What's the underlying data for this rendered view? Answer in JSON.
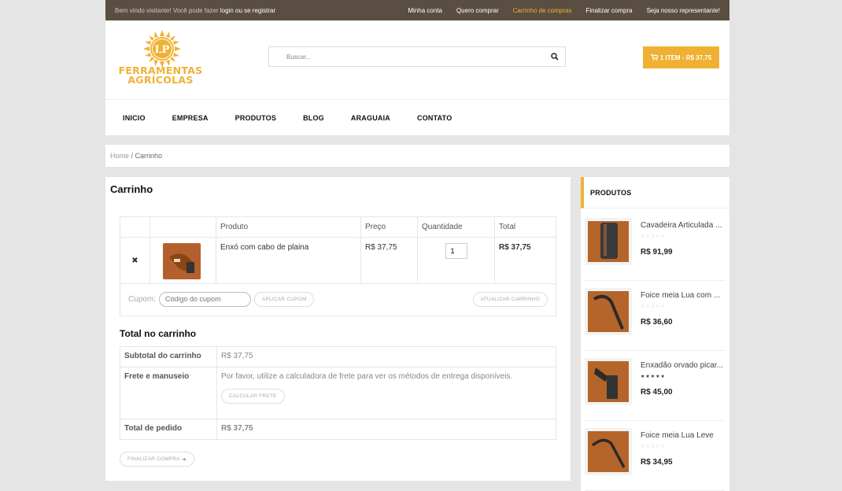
{
  "topbar": {
    "welcome": "Bem vindo visitante! Você pode fazer",
    "login": "login ou se registrar",
    "links": [
      "Minha conta",
      "Quero comprar",
      "Carrinho de compras",
      "Finalizar compra",
      "Seja nosso representante!"
    ],
    "active_link": "Carrinho de compras"
  },
  "logo": {
    "initials": "LP",
    "line1": "FERRAMENTAS",
    "line2": "AGRÍCOLAS"
  },
  "search": {
    "placeholder": "Buscar..."
  },
  "cart_button": {
    "label": "1 ITEM - R$ 37,75"
  },
  "nav": [
    "INICIO",
    "EMPRESA",
    "PRODUTOS",
    "BLOG",
    "ARAGUAIA",
    "CONTATO"
  ],
  "breadcrumb": {
    "home": "Home",
    "current": "Carrinho"
  },
  "cart": {
    "title": "Carrinho",
    "headers": {
      "product": "Produto",
      "price": "Preço",
      "quantity": "Quantidade",
      "total": "Total"
    },
    "items": [
      {
        "name": "Enxó com cabo de plaina",
        "price": "R$ 37,75",
        "quantity": "1",
        "total": "R$ 37,75"
      }
    ],
    "coupon_label": "Cupom:",
    "coupon_placeholder": "Código do cupom",
    "apply_coupon": "APLICAR CUPOM",
    "update_cart": "ATUALIZAR CARRINHO"
  },
  "totals": {
    "title": "Total no carrinho",
    "subtotal_label": "Subtotal do carrinho",
    "subtotal_value": "R$ 37,75",
    "shipping_label": "Frete e manuseio",
    "shipping_text": "Por favor, utilize a calculadora de frete para ver os métodos de entrega disponíveis.",
    "calculate_shipping": "CALCULAR FRETE",
    "order_total_label": "Total de pedido",
    "order_total_value": "R$ 37,75",
    "checkout": "FINALIZAR COMPRA"
  },
  "sidebar": {
    "title": "PRODUTOS",
    "products": [
      {
        "name": "Cavadeira Articulada ...",
        "stars": "☆☆☆☆☆",
        "price": "R$ 91,99"
      },
      {
        "name": "Foice meia Lua com ...",
        "stars": "☆☆☆☆☆",
        "price": "R$ 36,60"
      },
      {
        "name": "Enxadão orvado picar...",
        "stars": "★★★★★",
        "price": "R$ 45,00"
      },
      {
        "name": "Foice meia Lua Leve",
        "stars": "☆☆☆☆☆",
        "price": "R$ 34,95"
      }
    ]
  },
  "colors": {
    "accent": "#f0b133",
    "topbar": "#5a4e42",
    "price": "#e74c3c"
  }
}
